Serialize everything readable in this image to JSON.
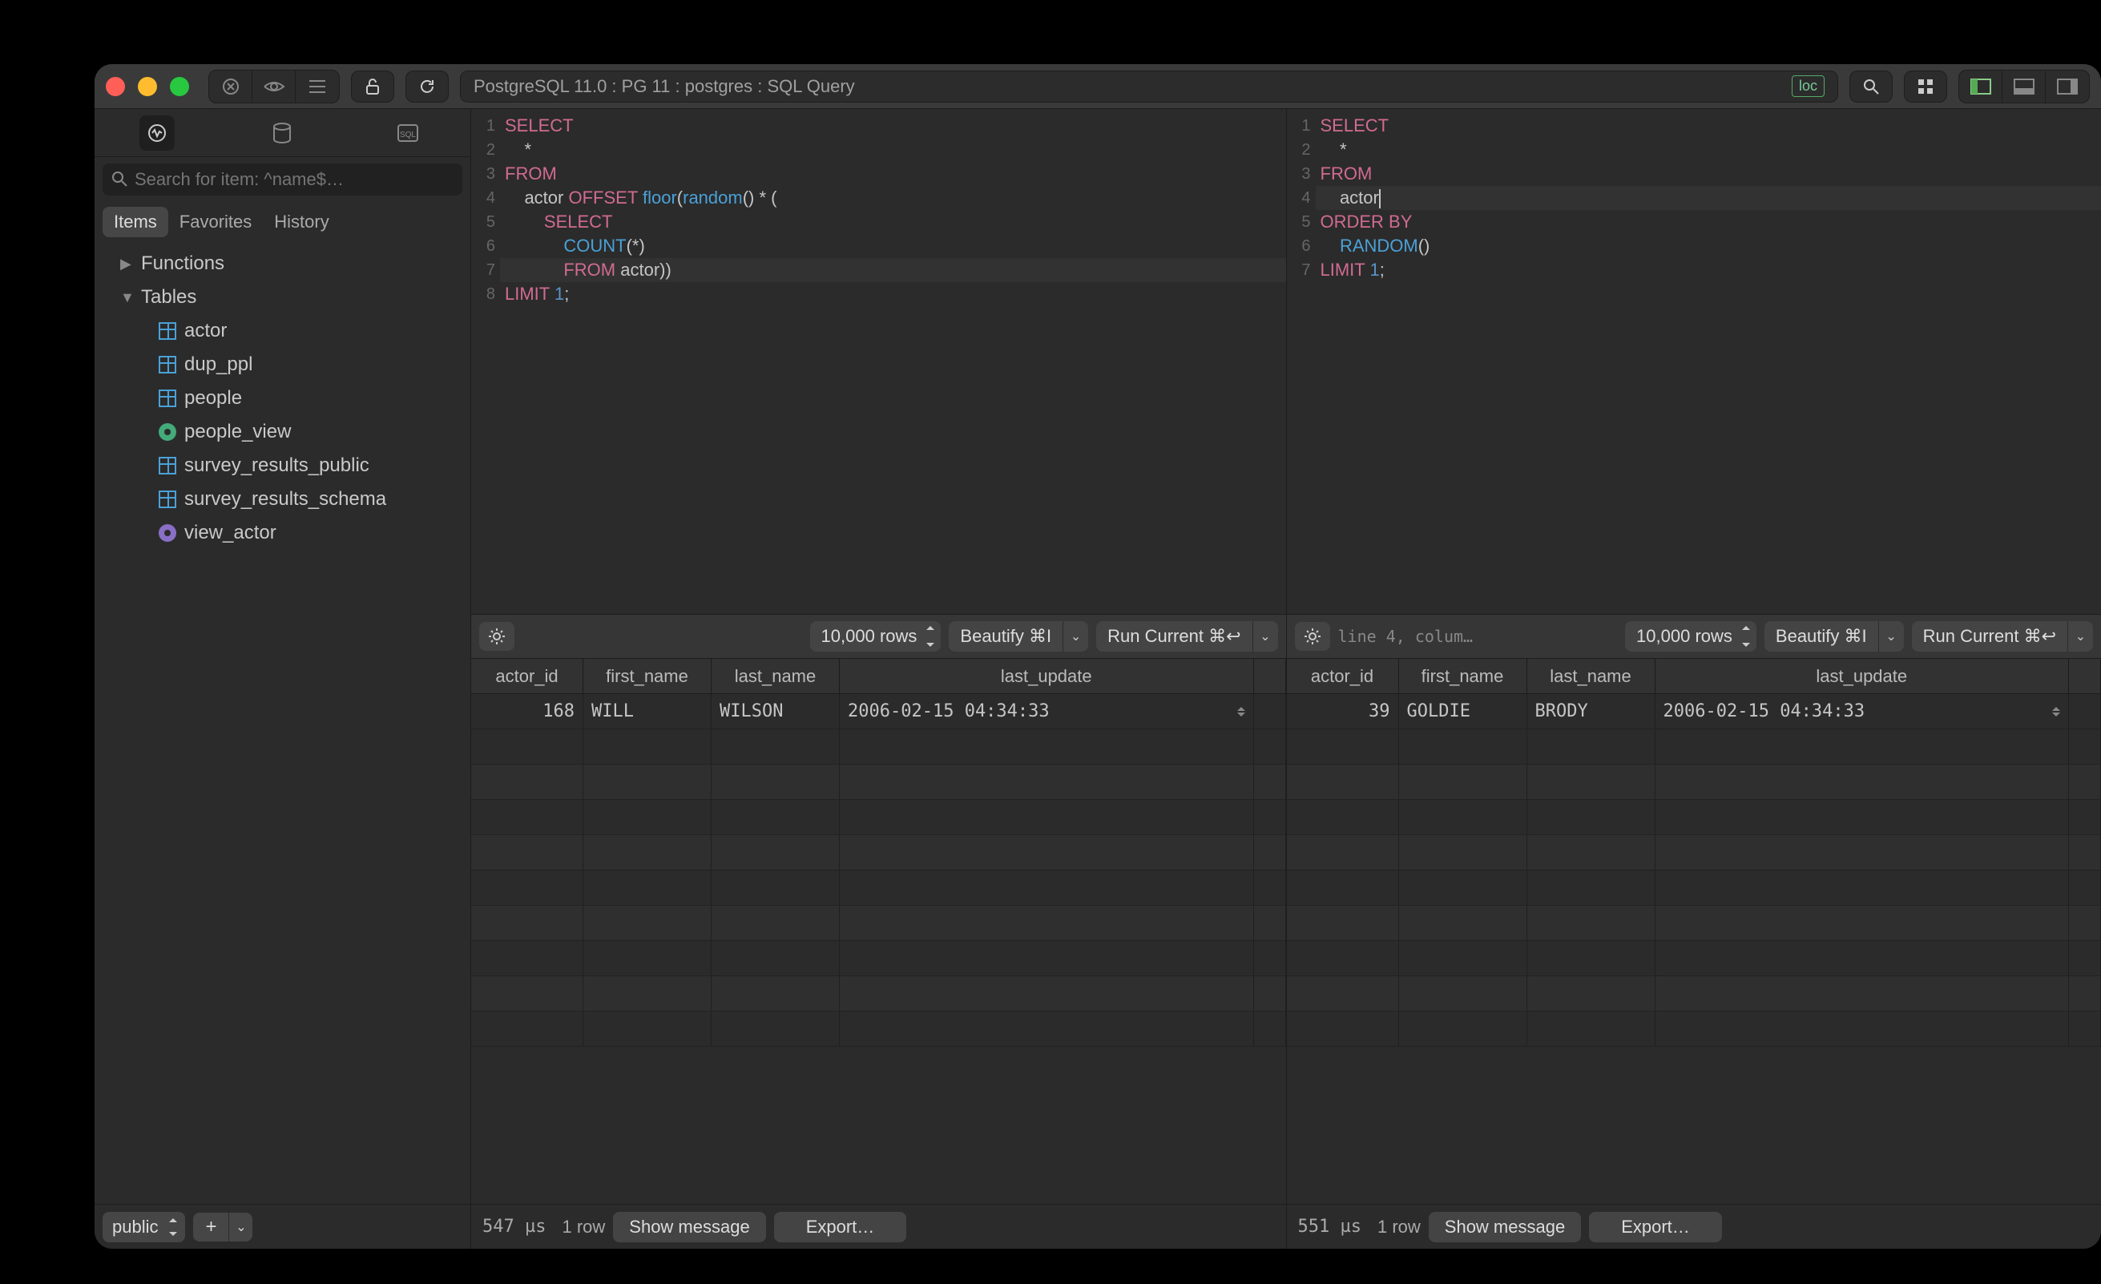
{
  "titlebar": {
    "path": "PostgreSQL 11.0 : PG 11 : postgres : SQL Query",
    "loc_badge": "loc"
  },
  "sidebar": {
    "search_placeholder": "Search for item: ^name$…",
    "filters": [
      "Items",
      "Favorites",
      "History"
    ],
    "active_filter": 0,
    "functions_label": "Functions",
    "tables_label": "Tables",
    "tables": [
      "actor",
      "dup_ppl",
      "people",
      "people_view",
      "survey_results_public",
      "survey_results_schema",
      "view_actor"
    ],
    "schema": "public"
  },
  "pane_left": {
    "code_lines": [
      [
        {
          "t": "SELECT",
          "c": "kw"
        }
      ],
      [
        {
          "t": "    *"
        }
      ],
      [
        {
          "t": "FROM",
          "c": "kw"
        }
      ],
      [
        {
          "t": "    actor "
        },
        {
          "t": "OFFSET",
          "c": "kw"
        },
        {
          "t": " "
        },
        {
          "t": "floor",
          "c": "fn"
        },
        {
          "t": "("
        },
        {
          "t": "random",
          "c": "fn"
        },
        {
          "t": "() * ("
        }
      ],
      [
        {
          "t": "        "
        },
        {
          "t": "SELECT",
          "c": "kw"
        }
      ],
      [
        {
          "t": "            "
        },
        {
          "t": "COUNT",
          "c": "fn"
        },
        {
          "t": "(*)"
        }
      ],
      [
        {
          "t": "            "
        },
        {
          "t": "FROM",
          "c": "kw"
        },
        {
          "t": " actor))"
        }
      ],
      [
        {
          "t": "LIMIT",
          "c": "kw"
        },
        {
          "t": " "
        },
        {
          "t": "1",
          "c": "num"
        },
        {
          "t": ";"
        }
      ]
    ],
    "highlight_line": 7,
    "rows_combo": "10,000 rows",
    "beautify": "Beautify ⌘I",
    "run": "Run Current ⌘↩",
    "columns": [
      "actor_id",
      "first_name",
      "last_name",
      "last_update"
    ],
    "data_row": {
      "actor_id": "168",
      "first_name": "WILL",
      "last_name": "WILSON",
      "last_update": "2006-02-15 04:34:33"
    },
    "elapsed": "547 µs",
    "row_count": "1 row",
    "show_msg": "Show message",
    "export": "Export…"
  },
  "pane_right": {
    "code_lines": [
      [
        {
          "t": "SELECT",
          "c": "kw"
        }
      ],
      [
        {
          "t": "    *"
        }
      ],
      [
        {
          "t": "FROM",
          "c": "kw"
        }
      ],
      [
        {
          "t": "    actor"
        },
        {
          "cursor": true
        }
      ],
      [
        {
          "t": "ORDER BY",
          "c": "kw"
        }
      ],
      [
        {
          "t": "    "
        },
        {
          "t": "RANDOM",
          "c": "fn"
        },
        {
          "t": "()"
        }
      ],
      [
        {
          "t": "LIMIT",
          "c": "kw"
        },
        {
          "t": " "
        },
        {
          "t": "1",
          "c": "num"
        },
        {
          "t": ";"
        }
      ]
    ],
    "highlight_line": 4,
    "status": "line 4, colum…",
    "rows_combo": "10,000 rows",
    "beautify": "Beautify ⌘I",
    "run": "Run Current ⌘↩",
    "columns": [
      "actor_id",
      "first_name",
      "last_name",
      "last_update"
    ],
    "data_row": {
      "actor_id": "39",
      "first_name": "GOLDIE",
      "last_name": "BRODY",
      "last_update": "2006-02-15 04:34:33"
    },
    "elapsed": "551 µs",
    "row_count": "1 row",
    "show_msg": "Show message",
    "export": "Export…"
  }
}
